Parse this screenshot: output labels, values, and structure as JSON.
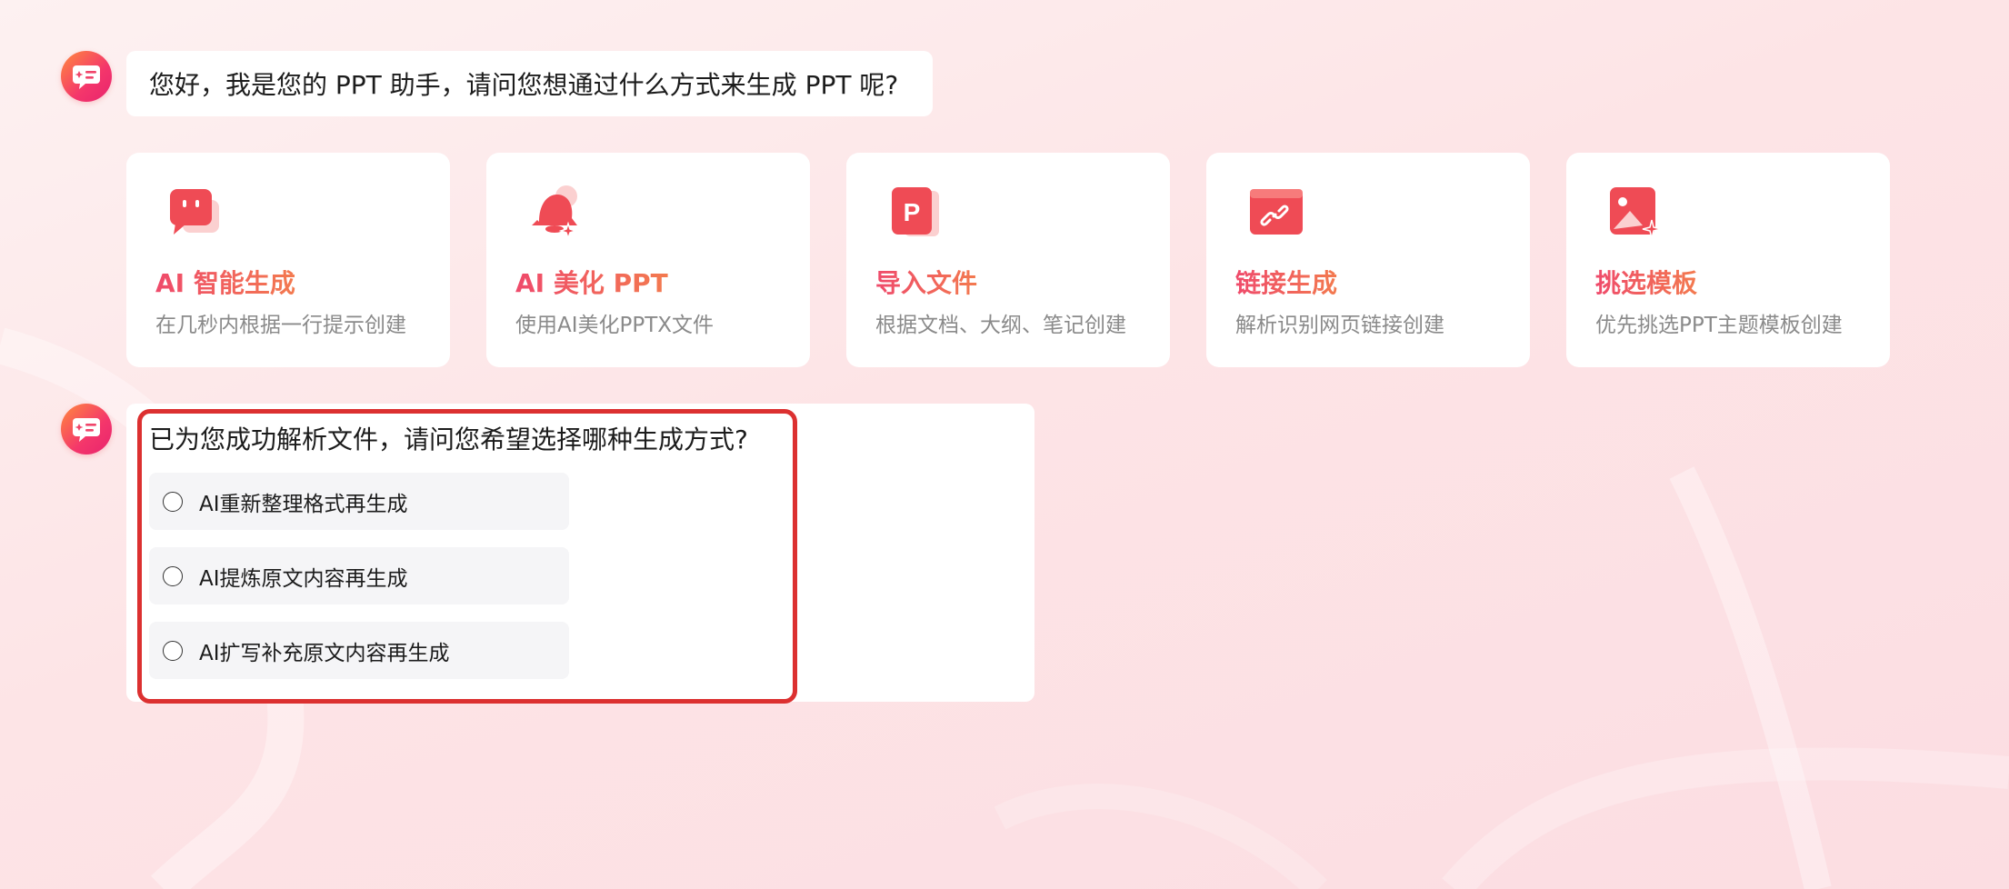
{
  "colors": {
    "accent_start": "#ef4a6b",
    "accent_end": "#f37a4f",
    "highlight_border": "#dc3030"
  },
  "greeting": {
    "avatar_icon": "assistant-chat-icon",
    "text": "您好，我是您的 PPT 助手，请问您想通过什么方式来生成 PPT 呢?"
  },
  "cards": [
    {
      "icon": "chat-bubble-icon",
      "title": "AI 智能生成",
      "desc": "在几秒内根据一行提示创建"
    },
    {
      "icon": "magic-bell-icon",
      "title": "AI 美化 PPT",
      "desc": "使用AI美化PPTX文件"
    },
    {
      "icon": "ppt-file-icon",
      "title": "导入文件",
      "desc": "根据文档、大纲、笔记创建"
    },
    {
      "icon": "link-icon",
      "title": "链接生成",
      "desc": "解析识别网页链接创建"
    },
    {
      "icon": "template-image-icon",
      "title": "挑选模板",
      "desc": "优先挑选PPT主题模板创建"
    }
  ],
  "reply": {
    "avatar_icon": "assistant-chat-icon",
    "question": "已为您成功解析文件，请问您希望选择哪种生成方式?",
    "options": [
      {
        "label": "AI重新整理格式再生成",
        "selected": false
      },
      {
        "label": "AI提炼原文内容再生成",
        "selected": false
      },
      {
        "label": "AI扩写补充原文内容再生成",
        "selected": false
      }
    ]
  }
}
